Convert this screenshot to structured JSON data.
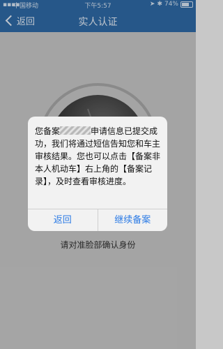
{
  "status_bar": {
    "carrier": "中国移动",
    "time": "下午5:57",
    "battery_percent": "74%",
    "battery_level": 0.74
  },
  "nav": {
    "back_label": "返回",
    "title": "实人认证"
  },
  "content": {
    "instruction": "请对准脸部确认身份"
  },
  "dialog": {
    "message_before_plate": "您备案",
    "message_after_plate": "申请信息已提交成功，我们将通过短信告知您和车主审核结果。您也可以点击【备案非本人机动车】右上角的【备案记录】，及时查看审核进度。",
    "buttons": {
      "back": "返回",
      "continue": "继续备案"
    }
  },
  "colors": {
    "header_blue": "#2f6ba8",
    "button_blue": "#2c7be5"
  }
}
